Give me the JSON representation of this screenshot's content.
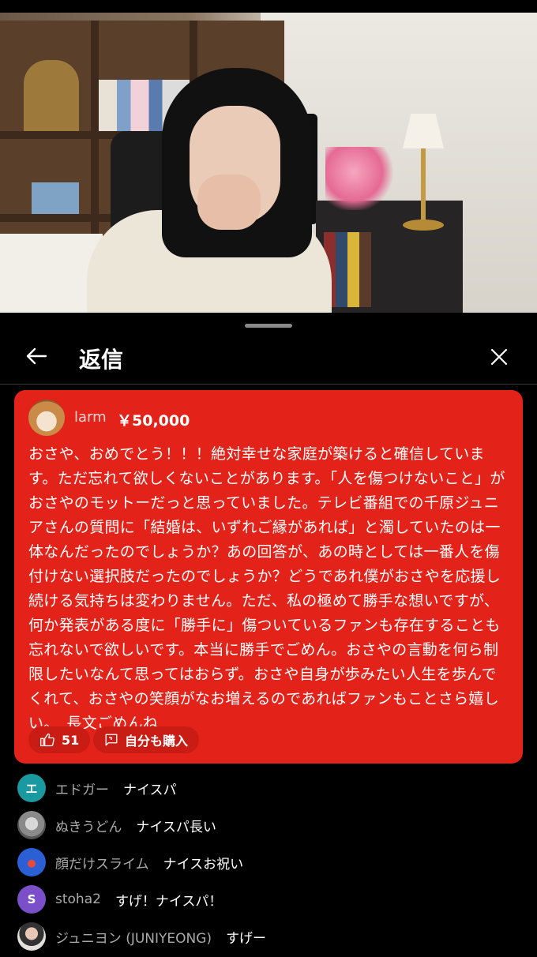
{
  "header": {
    "title": "返信"
  },
  "highlight": {
    "author": "larm",
    "amount": "￥50,000",
    "message": "おさや、おめでとう！！！絶対幸せな家庭が築けると確信しています。ただ忘れて欲しくないことがあります。「人を傷つけないこと」がおさやのモットーだっと思っていました。テレビ番組での千原ジュニアさんの質問に「結婚は、いずれご縁があれば」と濁していたのは一体なんだったのでしょうか？あの回答が、あの時としては一番人を傷付けない選択肢だったのでしょうか？どうであれ僕がおさやを応援し続ける気持ちは変わりません。ただ、私の極めて勝手な想いですが、何か発表がある度に「勝手に」傷ついているファンも存在することも忘れないで欲しいです。本当に勝手でごめん。おさやの言動を何ら制限したいなんて思ってはおらず。おさや自身が歩みたい人生を歩んでくれて、おさやの笑顔がなお増えるのであればファンもことさら嬉しい。　長文ごめんね",
    "like_count": "51",
    "buy_label": "自分も購入"
  },
  "comments": [
    {
      "avatar_letter": "エ",
      "avatar_color": "#1a9aa0",
      "name": "エドガー",
      "text": "ナイスパ"
    },
    {
      "avatar_letter": "",
      "avatar_color": "#7a7a7a",
      "name": "ぬきうどん",
      "text": "ナイスパ長い"
    },
    {
      "avatar_letter": "",
      "avatar_color": "#2a5fd6",
      "name": "顔だけスライム",
      "text": "ナイスお祝い"
    },
    {
      "avatar_letter": "S",
      "avatar_color": "#7b4fc9",
      "name": "stoha2",
      "text": "すげ！ナイスパ！"
    },
    {
      "avatar_letter": "",
      "avatar_color": "#d9d0cc",
      "name": "ジュニヨン (JUNIYEONG)",
      "text": "すげー"
    }
  ]
}
